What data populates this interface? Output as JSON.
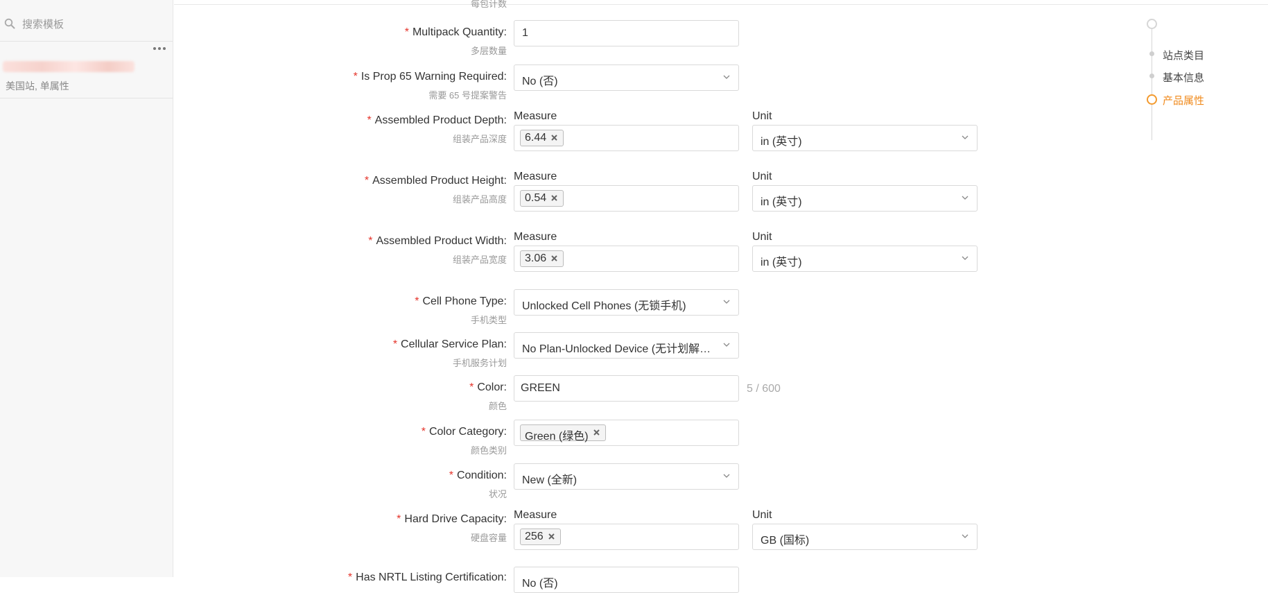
{
  "sidebar": {
    "search_placeholder": "搜索模板",
    "template_meta": "美国站, 单属性"
  },
  "form": {
    "top_cut_sub": "每包计数",
    "fields": [
      {
        "label": "Multipack Quantity:",
        "sub": "多层数量",
        "value": "1"
      },
      {
        "label": "Is Prop 65 Warning Required:",
        "sub": "需要 65 号提案警告",
        "value": "No (否)"
      },
      {
        "label": "Assembled Product Depth:",
        "sub": "组装产品深度",
        "measure_label": "Measure",
        "unit_label": "Unit",
        "tag": "6.44",
        "unit": "in (英寸)"
      },
      {
        "label": "Assembled Product Height:",
        "sub": "组装产品高度",
        "measure_label": "Measure",
        "unit_label": "Unit",
        "tag": "0.54",
        "unit": "in (英寸)"
      },
      {
        "label": "Assembled Product Width:",
        "sub": "组装产品宽度",
        "measure_label": "Measure",
        "unit_label": "Unit",
        "tag": "3.06",
        "unit": "in (英寸)"
      },
      {
        "label": "Cell Phone Type:",
        "sub": "手机类型",
        "value": "Unlocked Cell Phones (无锁手机)"
      },
      {
        "label": "Cellular Service Plan:",
        "sub": "手机服务计划",
        "value": "No Plan-Unlocked Device (无计划解锁设备)"
      },
      {
        "label": "Color:",
        "sub": "颜色",
        "value": "GREEN",
        "counter": "5 / 600"
      },
      {
        "label": "Color Category:",
        "sub": "颜色类别",
        "tag": "Green (绿色)"
      },
      {
        "label": "Condition:",
        "sub": "状况",
        "value": "New (全新)"
      },
      {
        "label": "Hard Drive Capacity:",
        "sub": "硬盘容量",
        "measure_label": "Measure",
        "unit_label": "Unit",
        "tag": "256",
        "unit": "GB (国标)"
      },
      {
        "label": "Has NRTL Listing Certification:",
        "value": "No (否)"
      }
    ]
  },
  "steps": {
    "items": [
      "站点类目",
      "基本信息",
      "产品属性"
    ],
    "active_index": 2
  },
  "colors": {
    "accent": "#f08a1c",
    "required": "#e5342b"
  },
  "icons": {
    "search": "search-icon",
    "more": "more-icon",
    "chevron": "chevron-down-icon",
    "tag_remove": "close-icon"
  }
}
